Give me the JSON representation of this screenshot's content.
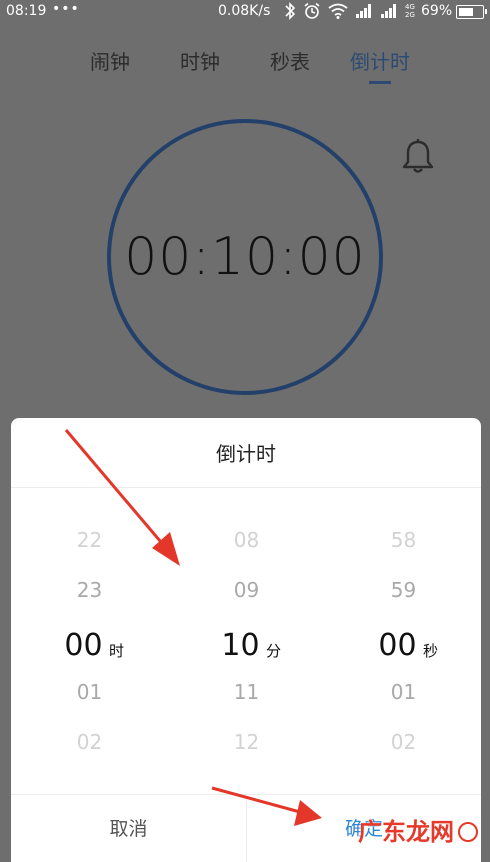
{
  "status": {
    "time": "08:19",
    "dots": "•••",
    "net_speed": "0.08K/s",
    "net_type_top": "4G",
    "net_type_bottom": "2G",
    "battery_percent": "69%",
    "battery_level": 0.69
  },
  "tabs": [
    {
      "label": "闹钟"
    },
    {
      "label": "时钟"
    },
    {
      "label": "秒表"
    },
    {
      "label": "倒计时",
      "active": true
    }
  ],
  "timer": {
    "display": "00:10:00"
  },
  "picker": {
    "title": "倒计时",
    "hours": {
      "values": [
        "22",
        "23",
        "00",
        "01",
        "02"
      ],
      "unit": "时"
    },
    "minutes": {
      "values": [
        "08",
        "09",
        "10",
        "11",
        "12"
      ],
      "unit": "分"
    },
    "seconds": {
      "values": [
        "58",
        "59",
        "00",
        "01",
        "02"
      ],
      "unit": "秒"
    },
    "cancel_label": "取消",
    "ok_label": "确定"
  },
  "watermark": {
    "text": "广东龙网"
  },
  "colors": {
    "accent": "#2c4a72",
    "ring": "#22406a",
    "confirm": "#2c86d6",
    "arrow": "#e5362a"
  }
}
